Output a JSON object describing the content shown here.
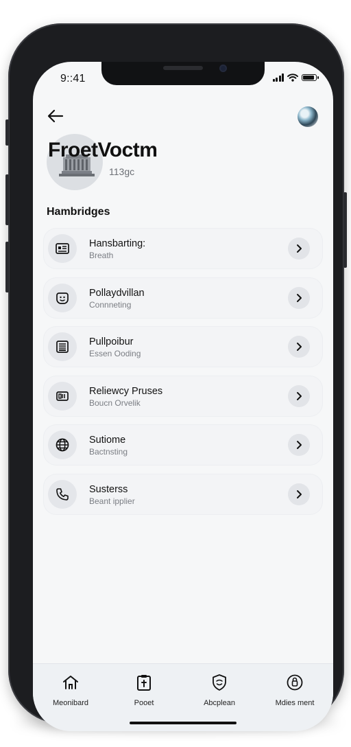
{
  "status_bar": {
    "time": "9::41"
  },
  "profile": {
    "name": "FroetVoctm",
    "subtitle": "113gc"
  },
  "section": {
    "title": "Hambridges"
  },
  "list": [
    {
      "title": "Hansbarting:",
      "subtitle": "Breath",
      "icon": "id-card-icon"
    },
    {
      "title": "Pollaydvillan",
      "subtitle": "Connneting",
      "icon": "face-badge-icon"
    },
    {
      "title": "Pullpoibur",
      "subtitle": "Essen Ooding",
      "icon": "ledger-icon"
    },
    {
      "title": "Reliewcy Pruses",
      "subtitle": "Boucn Orvelik",
      "icon": "card-slot-icon"
    },
    {
      "title": "Sutiome",
      "subtitle": "Bactnsting",
      "icon": "globe-icon"
    },
    {
      "title": "Susterss",
      "subtitle": "Beant ipplier",
      "icon": "phone-icon"
    }
  ],
  "tabbar": [
    {
      "label": "Meonibard",
      "icon": "home-icon"
    },
    {
      "label": "Pooet",
      "icon": "clipboard-icon"
    },
    {
      "label": "Abcplean",
      "icon": "shield-icon"
    },
    {
      "label": "Mdies ment",
      "icon": "lock-circle-icon"
    }
  ],
  "colors": {
    "screen_background": "#f6f7f8",
    "phone_frame": "#1c1d20",
    "row_background": "#f3f4f6",
    "tabbar_background": "#eef1f4"
  }
}
